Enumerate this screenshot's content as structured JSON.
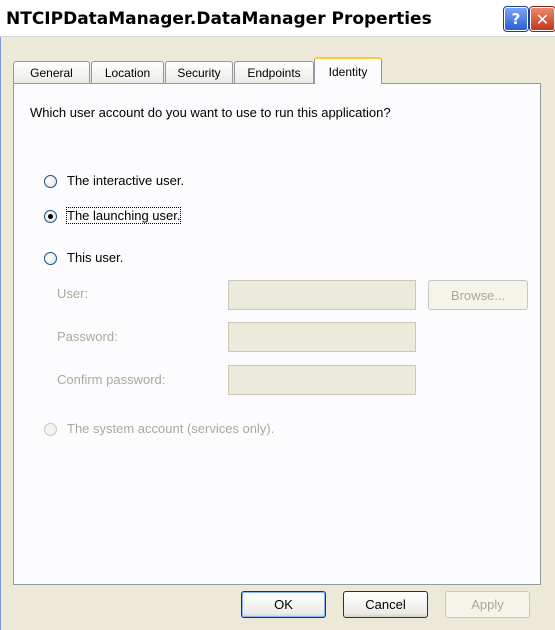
{
  "window": {
    "title": "NTCIPDataManager.DataManager Properties",
    "help_glyph": "?",
    "close_glyph": "✕"
  },
  "tabs": [
    {
      "label": "General",
      "active": false
    },
    {
      "label": "Location",
      "active": false
    },
    {
      "label": "Security",
      "active": false
    },
    {
      "label": "Endpoints",
      "active": false
    },
    {
      "label": "Identity",
      "active": true
    }
  ],
  "identity": {
    "prompt": "Which user account do you want to use to run this application?",
    "options": [
      {
        "label": "The interactive user.",
        "checked": false,
        "enabled": true
      },
      {
        "label": "The launching user.",
        "checked": true,
        "enabled": true
      },
      {
        "label": "This user.",
        "checked": false,
        "enabled": true
      },
      {
        "label": "The system account (services only).",
        "checked": false,
        "enabled": false
      }
    ],
    "user_label": "User:",
    "user_value": "",
    "browse_label": "Browse...",
    "password_label": "Password:",
    "password_value": "",
    "confirm_label": "Confirm password:",
    "confirm_value": ""
  },
  "buttons": {
    "ok": "OK",
    "cancel": "Cancel",
    "apply": "Apply"
  },
  "colors": {
    "tab_highlight": "#ffc83c",
    "button_border": "#003c74",
    "disabled_text": "#aca899",
    "dialog_background": "#ece9d8"
  }
}
